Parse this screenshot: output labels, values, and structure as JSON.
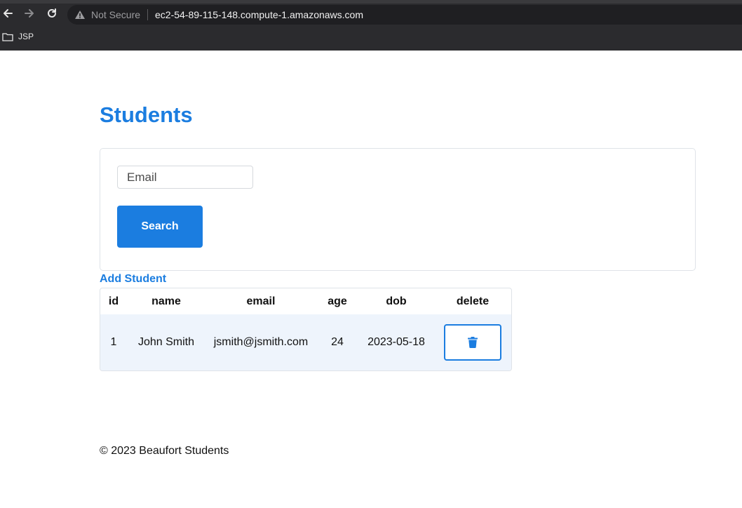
{
  "browser": {
    "security_label": "Not Secure",
    "url": "ec2-54-89-115-148.compute-1.amazonaws.com",
    "bookmark_folder": "JSP"
  },
  "page": {
    "title": "Students",
    "search": {
      "placeholder": "Email",
      "value": "",
      "button_label": "Search"
    },
    "add_link": "Add Student",
    "table": {
      "headers": [
        "id",
        "name",
        "email",
        "age",
        "dob",
        "delete"
      ],
      "rows": [
        {
          "id": "1",
          "name": "John Smith",
          "email": "jsmith@jsmith.com",
          "age": "24",
          "dob": "2023-05-18",
          "delete_icon": "trash-icon"
        }
      ]
    },
    "footer": "© 2023 Beaufort Students"
  },
  "colors": {
    "accent": "#1b7de0",
    "row_bg": "#eef4fc",
    "chrome_bg": "#2b2b2e"
  }
}
